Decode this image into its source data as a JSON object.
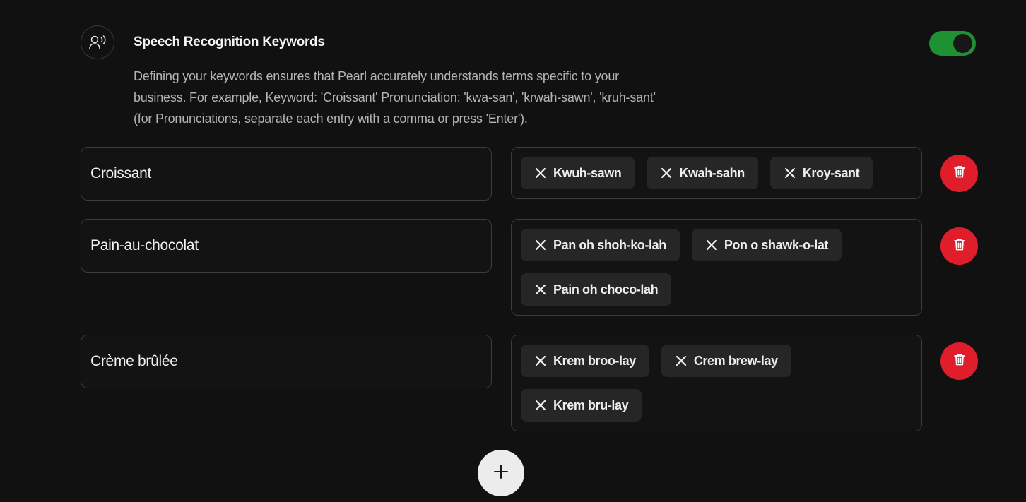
{
  "section": {
    "icon": "voice-user-icon",
    "title": "Speech Recognition Keywords",
    "description": "Defining your keywords ensures that Pearl accurately understands terms specific to your business. For example, Keyword: 'Croissant' Pronunciation: 'kwa-san', 'krwah-sawn', 'kruh-sant' (for Pronunciations, separate each entry with a comma or press 'Enter').",
    "toggle_on": true,
    "toggle_color": "#1e9133"
  },
  "keywords": [
    {
      "keyword": "Croissant",
      "pronunciations": [
        "Kwuh-sawn",
        "Kwah-sahn",
        "Kroy-sant"
      ]
    },
    {
      "keyword": "Pain-au-chocolat",
      "pronunciations": [
        "Pan oh shoh-ko-lah",
        "Pon o shawk-o-lat",
        "Pain oh choco-lah"
      ]
    },
    {
      "keyword": "Crème brûlée",
      "pronunciations": [
        "Krem broo-lay",
        "Crem brew-lay",
        "Krem bru-lay"
      ]
    }
  ],
  "actions": {
    "delete_icon": "trash-icon",
    "delete_color": "#e01e2b",
    "add_icon": "plus-icon",
    "remove_tag_icon": "close-icon"
  }
}
